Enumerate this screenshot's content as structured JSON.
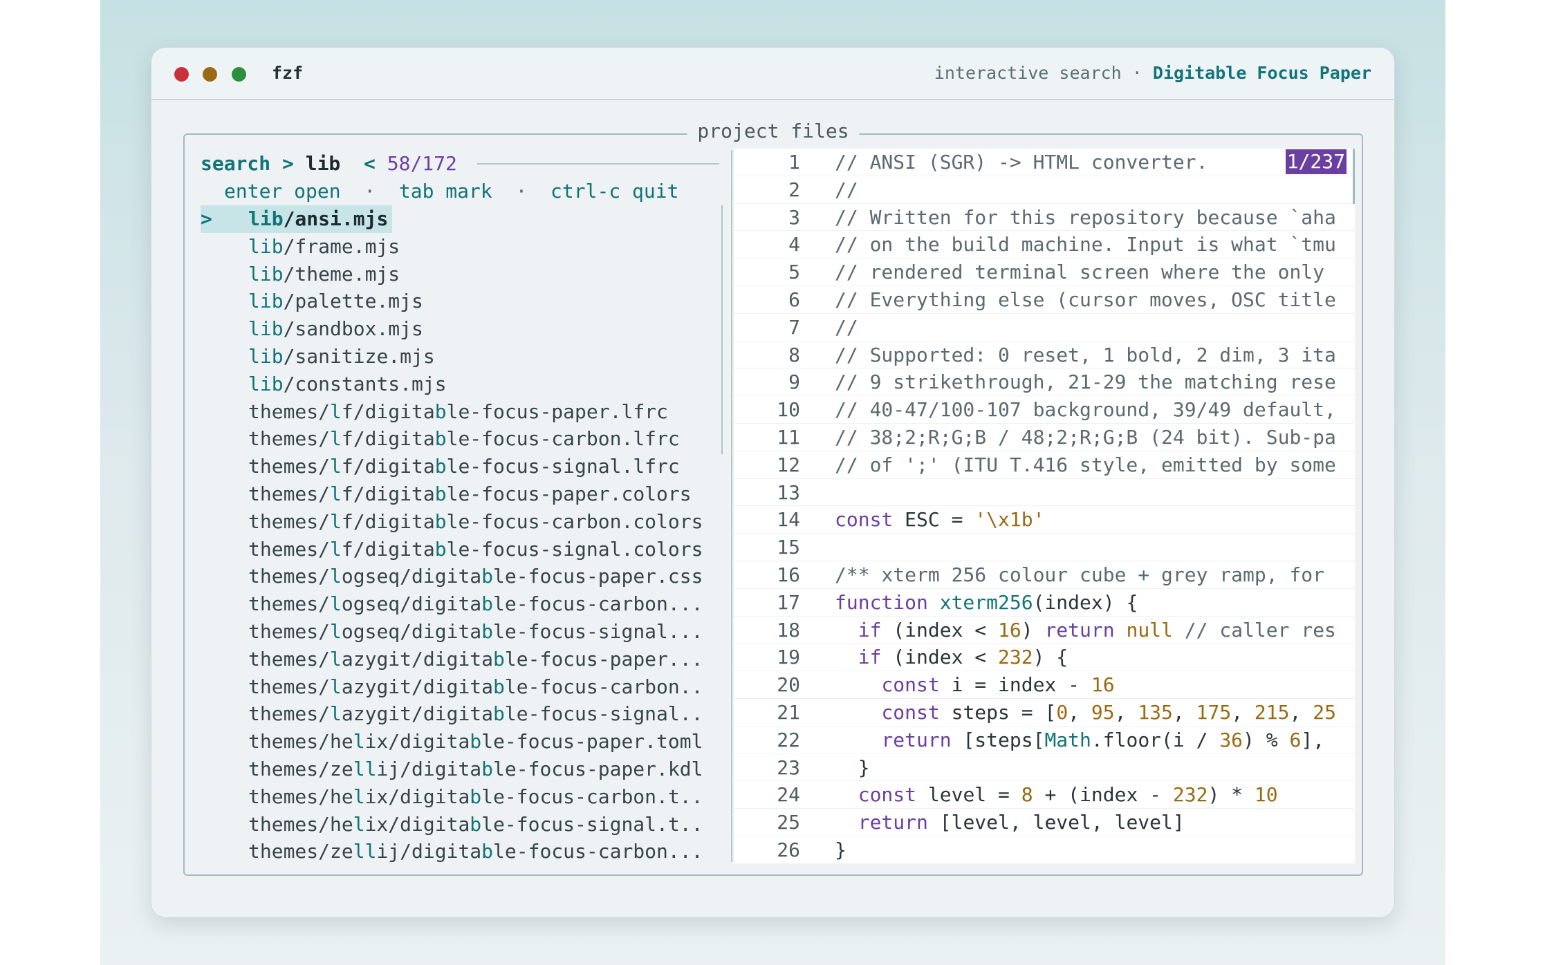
{
  "window": {
    "app_name": "fzf",
    "subtitle": "interactive search",
    "separator": "·",
    "theme_name": "Digitable Focus Paper"
  },
  "frame": {
    "label": "project files"
  },
  "prompt": {
    "label": "search >",
    "query": "lib",
    "count_marker": "<",
    "count": "58/172"
  },
  "help": {
    "enter": "enter open",
    "tab": "tab mark",
    "quit": "ctrl-c quit",
    "sep": "·"
  },
  "results": {
    "pointer": ">",
    "items": [
      {
        "pre": "",
        "m": "lib",
        "post": "/ansi.mjs"
      },
      {
        "pre": "",
        "m": "lib",
        "post": "/frame.mjs"
      },
      {
        "pre": "",
        "m": "lib",
        "post": "/theme.mjs"
      },
      {
        "pre": "",
        "m": "lib",
        "post": "/palette.mjs"
      },
      {
        "pre": "",
        "m": "lib",
        "post": "/sandbox.mjs"
      },
      {
        "pre": "",
        "m": "lib",
        "post": "/sanitize.mjs"
      },
      {
        "pre": "",
        "m": "lib",
        "post": "/constants.mjs"
      },
      {
        "pre": "themes/",
        "m": "l",
        "pre2": "f/digita",
        "m2": "b",
        "post": "le-focus-paper.lfrc"
      },
      {
        "pre": "themes/",
        "m": "l",
        "pre2": "f/digita",
        "m2": "b",
        "post": "le-focus-carbon.lfrc"
      },
      {
        "pre": "themes/",
        "m": "l",
        "pre2": "f/digita",
        "m2": "b",
        "post": "le-focus-signal.lfrc"
      },
      {
        "pre": "themes/",
        "m": "l",
        "pre2": "f/digita",
        "m2": "b",
        "post": "le-focus-paper.colors"
      },
      {
        "pre": "themes/",
        "m": "l",
        "pre2": "f/digita",
        "m2": "b",
        "post": "le-focus-carbon.colors"
      },
      {
        "pre": "themes/",
        "m": "l",
        "pre2": "f/digita",
        "m2": "b",
        "post": "le-focus-signal.colors"
      },
      {
        "pre": "themes/",
        "m": "l",
        "pre2": "ogseq/digita",
        "m2": "b",
        "post": "le-focus-paper.css"
      },
      {
        "pre": "themes/",
        "m": "l",
        "pre2": "ogseq/digita",
        "m2": "b",
        "post": "le-focus-carbon..."
      },
      {
        "pre": "themes/",
        "m": "l",
        "pre2": "ogseq/digita",
        "m2": "b",
        "post": "le-focus-signal..."
      },
      {
        "pre": "themes/",
        "m": "l",
        "pre2": "azygit/digita",
        "m2": "b",
        "post": "le-focus-paper..."
      },
      {
        "pre": "themes/",
        "m": "l",
        "pre2": "azygit/digita",
        "m2": "b",
        "post": "le-focus-carbon.."
      },
      {
        "pre": "themes/",
        "m": "l",
        "pre2": "azygit/digita",
        "m2": "b",
        "post": "le-focus-signal.."
      },
      {
        "pre": "themes/he",
        "m": "l",
        "pre2": "ix/digita",
        "m2": "b",
        "post": "le-focus-paper.toml"
      },
      {
        "pre": "themes/ze",
        "m": "ll",
        "pre2": "ij/digita",
        "m2": "b",
        "post": "le-focus-paper.kdl"
      },
      {
        "pre": "themes/he",
        "m": "l",
        "pre2": "ix/digita",
        "m2": "b",
        "post": "le-focus-carbon.t.."
      },
      {
        "pre": "themes/he",
        "m": "l",
        "pre2": "ix/digita",
        "m2": "b",
        "post": "le-focus-signal.t.."
      },
      {
        "pre": "themes/ze",
        "m": "ll",
        "pre2": "ij/digita",
        "m2": "b",
        "post": "le-focus-carbon..."
      }
    ]
  },
  "preview": {
    "position": "1/237",
    "lines": [
      {
        "n": "1",
        "t": [
          [
            "cm",
            "// ANSI (SGR) -> HTML converter."
          ]
        ]
      },
      {
        "n": "2",
        "t": [
          [
            "cm",
            "//"
          ]
        ]
      },
      {
        "n": "3",
        "t": [
          [
            "cm",
            "// Written for this repository because `aha"
          ]
        ]
      },
      {
        "n": "4",
        "t": [
          [
            "cm",
            "// on the build machine. Input is what `tmu"
          ]
        ]
      },
      {
        "n": "5",
        "t": [
          [
            "cm",
            "// rendered terminal screen where the only"
          ]
        ]
      },
      {
        "n": "6",
        "t": [
          [
            "cm",
            "// Everything else (cursor moves, OSC title"
          ]
        ]
      },
      {
        "n": "7",
        "t": [
          [
            "cm",
            "//"
          ]
        ]
      },
      {
        "n": "8",
        "t": [
          [
            "cm",
            "// Supported: 0 reset, 1 bold, 2 dim, 3 ita"
          ]
        ]
      },
      {
        "n": "9",
        "t": [
          [
            "cm",
            "// 9 strikethrough, 21-29 the matching rese"
          ]
        ]
      },
      {
        "n": "10",
        "t": [
          [
            "cm",
            "// 40-47/100-107 background, 39/49 default,"
          ]
        ]
      },
      {
        "n": "11",
        "t": [
          [
            "cm",
            "// 38;2;R;G;B / 48;2;R;G;B (24 bit). Sub-pa"
          ]
        ]
      },
      {
        "n": "12",
        "t": [
          [
            "cm",
            "// of ';' (ITU T.416 style, emitted by some"
          ]
        ]
      },
      {
        "n": "13",
        "t": []
      },
      {
        "n": "14",
        "t": [
          [
            "kw",
            "const"
          ],
          [
            "",
            " ESC = "
          ],
          [
            "str",
            "'\\x1b'"
          ]
        ]
      },
      {
        "n": "15",
        "t": []
      },
      {
        "n": "16",
        "t": [
          [
            "cm",
            "/** xterm 256 colour cube + grey ramp, for"
          ]
        ]
      },
      {
        "n": "17",
        "t": [
          [
            "kw",
            "function"
          ],
          [
            "",
            " "
          ],
          [
            "fn",
            "xterm256"
          ],
          [
            "",
            "(index) {"
          ]
        ]
      },
      {
        "n": "18",
        "t": [
          [
            "",
            "  "
          ],
          [
            "kw",
            "if"
          ],
          [
            "",
            " (index < "
          ],
          [
            "num",
            "16"
          ],
          [
            "",
            ") "
          ],
          [
            "kw",
            "return"
          ],
          [
            "",
            " "
          ],
          [
            "num",
            "null"
          ],
          [
            "",
            " "
          ],
          [
            "cm",
            "// caller res"
          ]
        ]
      },
      {
        "n": "19",
        "t": [
          [
            "",
            "  "
          ],
          [
            "kw",
            "if"
          ],
          [
            "",
            " (index < "
          ],
          [
            "num",
            "232"
          ],
          [
            "",
            ") {"
          ]
        ]
      },
      {
        "n": "20",
        "t": [
          [
            "",
            "    "
          ],
          [
            "kw",
            "const"
          ],
          [
            "",
            " i = index - "
          ],
          [
            "num",
            "16"
          ]
        ]
      },
      {
        "n": "21",
        "t": [
          [
            "",
            "    "
          ],
          [
            "kw",
            "const"
          ],
          [
            "",
            " steps = ["
          ],
          [
            "num",
            "0"
          ],
          [
            "",
            ", "
          ],
          [
            "num",
            "95"
          ],
          [
            "",
            ", "
          ],
          [
            "num",
            "135"
          ],
          [
            "",
            ", "
          ],
          [
            "num",
            "175"
          ],
          [
            "",
            ", "
          ],
          [
            "num",
            "215"
          ],
          [
            "",
            ", "
          ],
          [
            "num",
            "25"
          ]
        ]
      },
      {
        "n": "22",
        "t": [
          [
            "",
            "    "
          ],
          [
            "kw",
            "return"
          ],
          [
            "",
            " [steps["
          ],
          [
            "fn",
            "Math"
          ],
          [
            "",
            ".floor(i / "
          ],
          [
            "num",
            "36"
          ],
          [
            "",
            ") % "
          ],
          [
            "num",
            "6"
          ],
          [
            "",
            "],"
          ]
        ]
      },
      {
        "n": "23",
        "t": [
          [
            "",
            "  }"
          ]
        ]
      },
      {
        "n": "24",
        "t": [
          [
            "",
            "  "
          ],
          [
            "kw",
            "const"
          ],
          [
            "",
            " level = "
          ],
          [
            "num",
            "8"
          ],
          [
            "",
            " + (index - "
          ],
          [
            "num",
            "232"
          ],
          [
            "",
            ") * "
          ],
          [
            "num",
            "10"
          ]
        ]
      },
      {
        "n": "25",
        "t": [
          [
            "",
            "  "
          ],
          [
            "kw",
            "return"
          ],
          [
            "",
            " [level, level, level]"
          ]
        ]
      },
      {
        "n": "26",
        "t": [
          [
            "",
            "}"
          ]
        ]
      }
    ]
  },
  "colors": {
    "accent": "#117479",
    "purple": "#6b3fa0",
    "number": "#9a6a12",
    "dot_red": "#c8303b",
    "dot_amber": "#9a6a12",
    "dot_green": "#2d8f3e"
  }
}
